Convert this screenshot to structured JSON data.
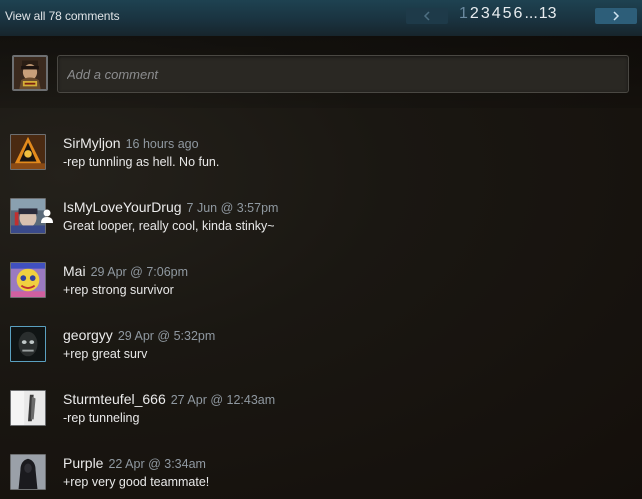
{
  "header": {
    "view_all": "View all 78 comments",
    "pages": [
      "1",
      "2",
      "3",
      "4",
      "5",
      "6"
    ],
    "ellipsis": "...",
    "last_page": "13",
    "current_page": "1"
  },
  "compose": {
    "placeholder": "Add a comment"
  },
  "comments": [
    {
      "author": "SirMyljon",
      "time": "16 hours ago",
      "text": "-rep tunnling as hell. No fun."
    },
    {
      "author": "IsMyLoveYourDrug",
      "time": "7 Jun @ 3:57pm",
      "text": "Great looper, really cool, kinda stinky~"
    },
    {
      "author": "Mai",
      "time": "29 Apr @ 7:06pm",
      "text": "+rep strong survivor"
    },
    {
      "author": "georgyy",
      "time": "29 Apr @ 5:32pm",
      "text": "+rep great surv"
    },
    {
      "author": "Sturmteufel_666",
      "time": "27 Apr @ 12:43am",
      "text": "-rep tunneling"
    },
    {
      "author": "Purple",
      "time": "22 Apr @ 3:34am",
      "text": "+rep very good teammate!"
    }
  ],
  "colors": {
    "accent": "#2d5e79",
    "timestamp": "#8f98a0",
    "text": "#e8e8e8"
  }
}
